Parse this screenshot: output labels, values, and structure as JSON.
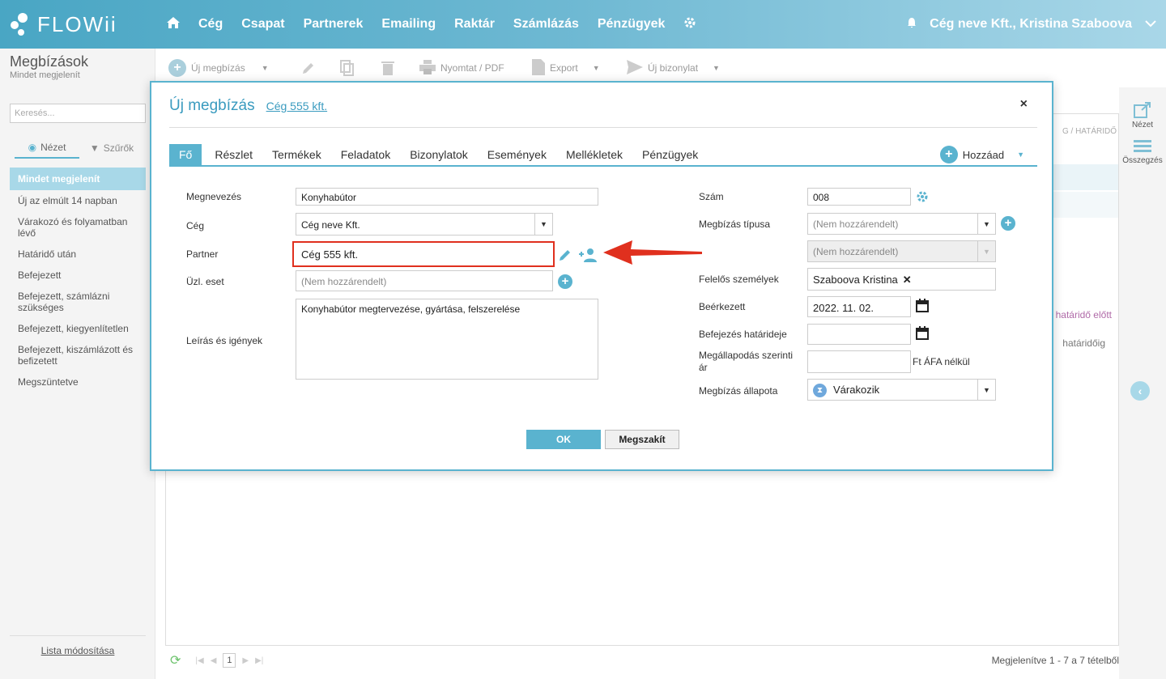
{
  "app": {
    "logo": "FLOWii"
  },
  "nav": [
    "Cég",
    "Csapat",
    "Partnerek",
    "Emailing",
    "Raktár",
    "Számlázás",
    "Pénzügyek"
  ],
  "user": "Cég neve Kft., Kristina Szaboova",
  "left": {
    "title": "Megbízások",
    "subtitle": "Mindet megjelenít",
    "search_placeholder": "Keresés...",
    "tab_view": "Nézet",
    "tab_filter": "Szűrők",
    "items": [
      "Mindet megjelenít",
      "Új az elmúlt 14 napban",
      "Várakozó és folyamatban lévő",
      "Határidő után",
      "Befejezett",
      "Befejezett, számlázni szükséges",
      "Befejezett, kiegyenlítetlen",
      "Befejezett, kiszámlázott és befizetett",
      "Megszüntetve"
    ],
    "list_edit": "Lista módosítása"
  },
  "toolbar": {
    "new": "Új megbízás",
    "print": "Nyomtat / PDF",
    "export": "Export",
    "new_doc": "Új bizonylat"
  },
  "right": {
    "view": "Nézet",
    "summary": "Összegzés"
  },
  "bg": {
    "header_frag": "G / HATÁRIDŐ",
    "row1": "határidő előtt",
    "row2": "határidőig"
  },
  "footer": {
    "page": "1",
    "info": "Megjelenítve 1 - 7 a 7 tételből"
  },
  "modal": {
    "title": "Új megbízás",
    "subtitle": "Cég 555 kft.",
    "close": "×",
    "tabs": [
      "Fő",
      "Részlet",
      "Termékek",
      "Feladatok",
      "Bizonylatok",
      "Események",
      "Mellékletek",
      "Pénzügyek"
    ],
    "add": "Hozzáad",
    "labels": {
      "name": "Megnevezés",
      "company": "Cég",
      "partner": "Partner",
      "case": "Üzl. eset",
      "desc": "Leírás és igények",
      "number": "Szám",
      "type": "Megbízás típusa",
      "responsible": "Felelős személyek",
      "received": "Beérkezett",
      "deadline": "Befejezés határideje",
      "price": "Megállapodás szerinti ár",
      "status": "Megbízás állapota"
    },
    "values": {
      "name": "Konyhabútor",
      "company": "Cég neve Kft.",
      "partner": "Cég 555 kft.",
      "case": "(Nem hozzárendelt)",
      "desc": "Konyhabútor megtervezése, gyártása, felszerelése",
      "number": "008",
      "type": "(Nem hozzárendelt)",
      "type2": "(Nem hozzárendelt)",
      "responsible": "Szaboova Kristina",
      "received": "2022. 11. 02.",
      "deadline": "",
      "price": "",
      "price_unit": "Ft ÁFA nélkül",
      "status": "Várakozik"
    },
    "ok": "OK",
    "cancel": "Megszakít"
  },
  "colors": {
    "accent": "#5ab3cf",
    "highlight": "#e0301e"
  }
}
